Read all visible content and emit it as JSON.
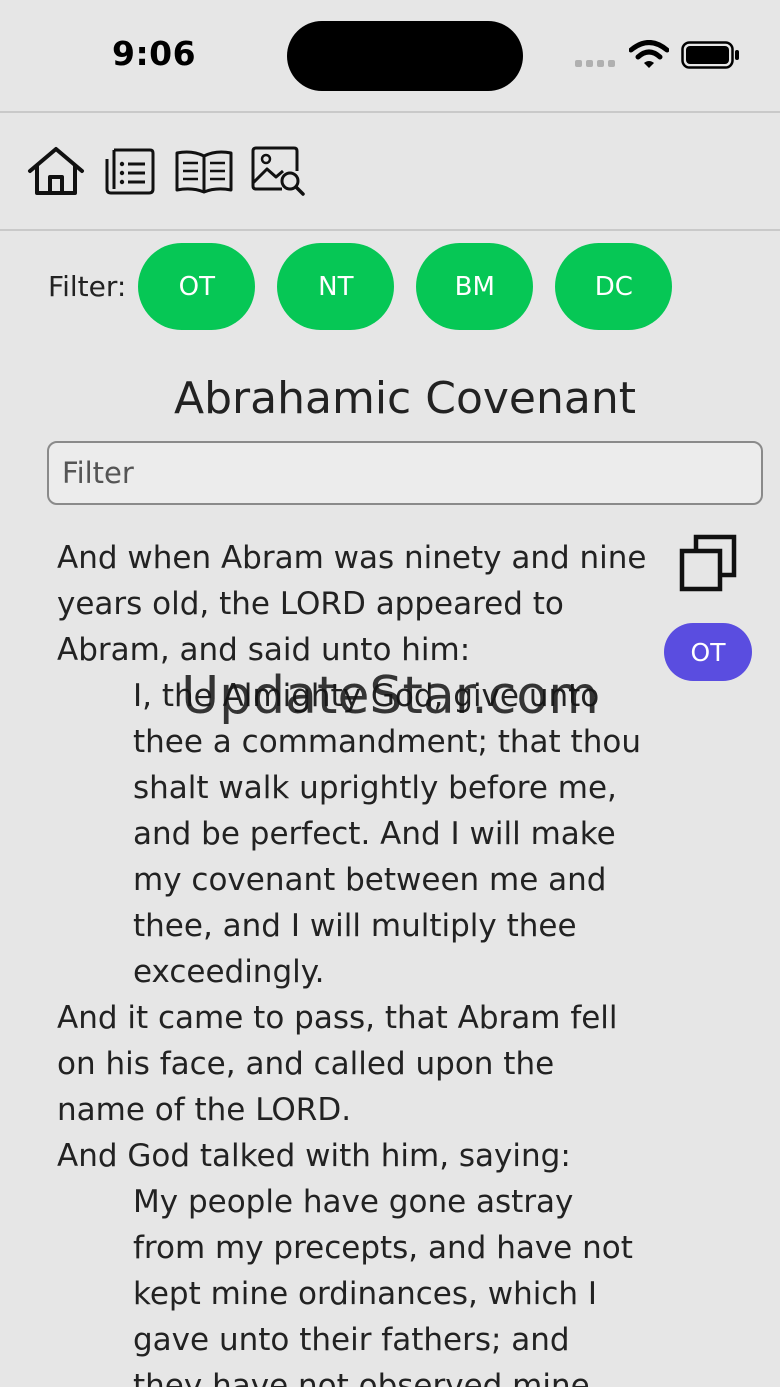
{
  "status_bar": {
    "time": "9:06"
  },
  "toolbar": {
    "icons": [
      "home-icon",
      "list-icon",
      "book-icon",
      "image-search-icon"
    ]
  },
  "filter": {
    "label": "Filter:",
    "chips": [
      "OT",
      "NT",
      "BM",
      "DC"
    ],
    "chip_color": "#06c755"
  },
  "page": {
    "title": "Abrahamic Covenant"
  },
  "search": {
    "placeholder": "Filter"
  },
  "passage": {
    "narration_1": "And when Abram was ninety and nine years old, the LORD appeared to Abram, and said unto him:",
    "quote_1": "I, the Almighty God, give unto thee a commandment; that thou shalt walk uprightly before me, and be perfect. And I will make my covenant between me and thee, and I will multiply thee exceedingly.",
    "narration_2": "And it came to pass, that Abram fell on his face, and called upon the name of the LORD.",
    "narration_3": "And God talked with him, saying:",
    "quote_2": "My people have gone astray from my precepts, and have not kept mine ordinances, which I gave unto their fathers; and they have not observed mine",
    "badge": "OT",
    "badge_color": "#5a4de0"
  },
  "watermark": "UpdateStar.com"
}
